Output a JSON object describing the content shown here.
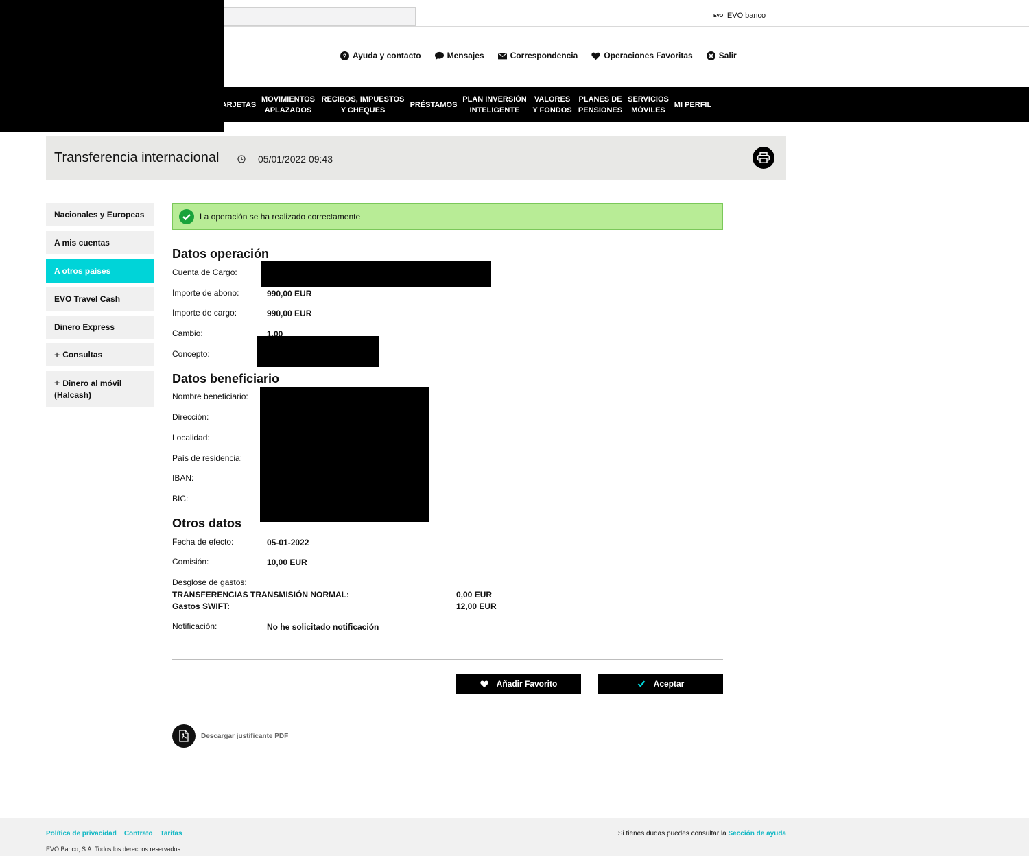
{
  "brand": {
    "mini": "EVO",
    "name": "EVO banco"
  },
  "utility": [
    {
      "label": "Ayuda y contacto"
    },
    {
      "label": "Mensajes"
    },
    {
      "label": "Correspondencia"
    },
    {
      "label": "Operaciones Favoritas"
    },
    {
      "label": "Salir"
    }
  ],
  "nav": [
    {
      "label": "ARJETAS"
    },
    {
      "label": "MOVIMIENTOS\nAPLAZADOS"
    },
    {
      "label": "RECIBOS, IMPUESTOS\nY CHEQUES"
    },
    {
      "label": "PRÉSTAMOS"
    },
    {
      "label": "PLAN INVERSIÓN\nINTELIGENTE"
    },
    {
      "label": "VALORES\nY FONDOS"
    },
    {
      "label": "PLANES DE\nPENSIONES"
    },
    {
      "label": "SERVICIOS\nMÓVILES"
    },
    {
      "label": "MI PERFIL"
    }
  ],
  "header": {
    "title": "Transferencia internacional",
    "datetime": "05/01/2022 09:43"
  },
  "sidebar": [
    {
      "label": "Nacionales y Europeas"
    },
    {
      "label": "A mis cuentas"
    },
    {
      "label": "A otros países",
      "active": true
    },
    {
      "label": "EVO Travel Cash"
    },
    {
      "label": "Dinero Express"
    },
    {
      "label": "Consultas"
    },
    {
      "label": "Dinero al móvil (Halcash)"
    }
  ],
  "success_message": "La operación se ha realizado correctamente",
  "operation": {
    "title": "Datos operación",
    "cuenta_label": "Cuenta de Cargo:",
    "abono_label": "Importe de abono:",
    "abono_value": "990,00 EUR",
    "cargo_label": "Importe de cargo:",
    "cargo_value": "990,00 EUR",
    "cambio_label": "Cambio:",
    "cambio_value": "1,00",
    "concepto_label": "Concepto:"
  },
  "beneficiary": {
    "title": "Datos beneficiario",
    "nombre_label": "Nombre beneficiario:",
    "direccion_label": "Dirección:",
    "localidad_label": "Localidad:",
    "pais_label": "País de residencia:",
    "iban_label": "IBAN:",
    "bic_label": "BIC:"
  },
  "other": {
    "title": "Otros datos",
    "fecha_label": "Fecha de efecto:",
    "fecha_value": "05-01-2022",
    "comision_label": "Comisión:",
    "comision_value": "10,00 EUR",
    "desglose_label": "Desglose de gastos:",
    "desglose": [
      {
        "concept": "TRANSFERENCIAS TRANSMISIÓN NORMAL:",
        "amount": "0,00 EUR"
      },
      {
        "concept": "Gastos SWIFT:",
        "amount": "12,00 EUR"
      }
    ],
    "notificacion_label": "Notificación:",
    "notificacion_value": "No he solicitado notificación"
  },
  "buttons": {
    "favorite": "Añadir Favorito",
    "accept": "Aceptar"
  },
  "pdf_link": "Descargar justificante PDF",
  "footer": {
    "links": [
      "Política de privacidad",
      "Contrato",
      "Tarifas"
    ],
    "copyright": "EVO Banco, S.A. Todos los derechos reservados.",
    "help_text": "Si tienes dudas puedes consultar la",
    "help_link": "Sección de ayuda"
  },
  "colors": {
    "accent": "#00d4d8",
    "link": "#14b8c4",
    "success_bg": "#b8ec96",
    "nav_bg": "#000000"
  }
}
